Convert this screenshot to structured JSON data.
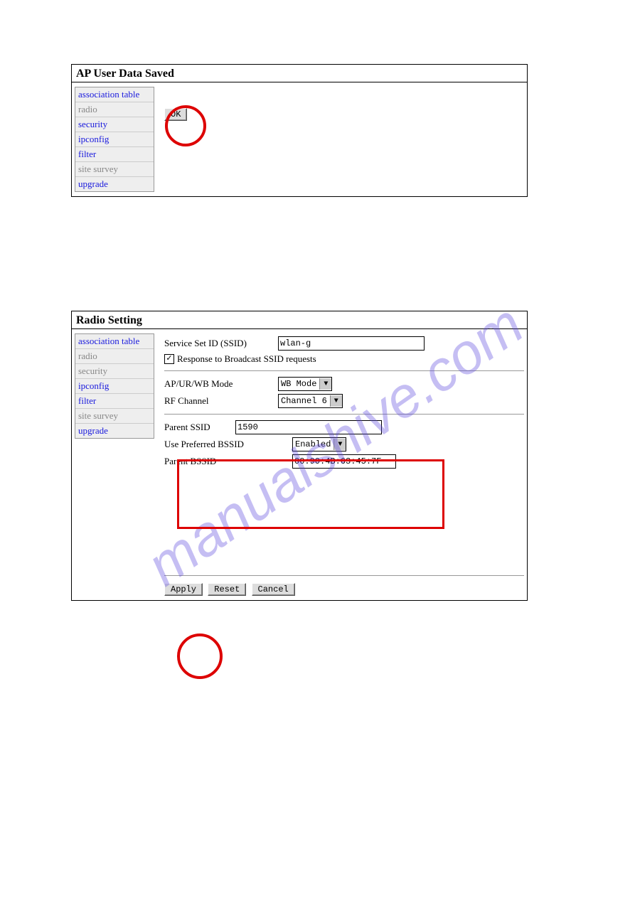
{
  "watermark": "manualshive.com",
  "panel1": {
    "title": "AP User Data Saved",
    "menu": [
      {
        "label": "association table",
        "disabled": false
      },
      {
        "label": "radio",
        "disabled": true
      },
      {
        "label": "security",
        "disabled": false
      },
      {
        "label": "ipconfig",
        "disabled": false
      },
      {
        "label": "filter",
        "disabled": false
      },
      {
        "label": "site survey",
        "disabled": true
      },
      {
        "label": "upgrade",
        "disabled": false
      }
    ],
    "ok_label": "OK"
  },
  "panel2": {
    "title": "Radio Setting",
    "menu": [
      {
        "label": "association table",
        "disabled": false
      },
      {
        "label": "radio",
        "disabled": true
      },
      {
        "label": "security",
        "disabled": true
      },
      {
        "label": "ipconfig",
        "disabled": false
      },
      {
        "label": "filter",
        "disabled": false
      },
      {
        "label": "site survey",
        "disabled": true
      },
      {
        "label": "upgrade",
        "disabled": false
      }
    ],
    "ssid_label": "Service Set ID (SSID)",
    "ssid_value": "wlan-g",
    "response_checked": true,
    "response_label": "Response to Broadcast SSID requests",
    "mode_label": "AP/UR/WB Mode",
    "mode_value": "WB Mode",
    "rf_label": "RF Channel",
    "rf_value": "Channel 6",
    "pssid_label": "Parent SSID",
    "pssid_value": "1590",
    "pref_label": "Use Preferred BSSID",
    "pref_value": "Enabled",
    "pbssid_label": "Parent BSSID",
    "pbssid_value": "00:90:4B:63:45:7F",
    "apply_label": "Apply",
    "reset_label": "Reset",
    "cancel_label": "Cancel"
  }
}
